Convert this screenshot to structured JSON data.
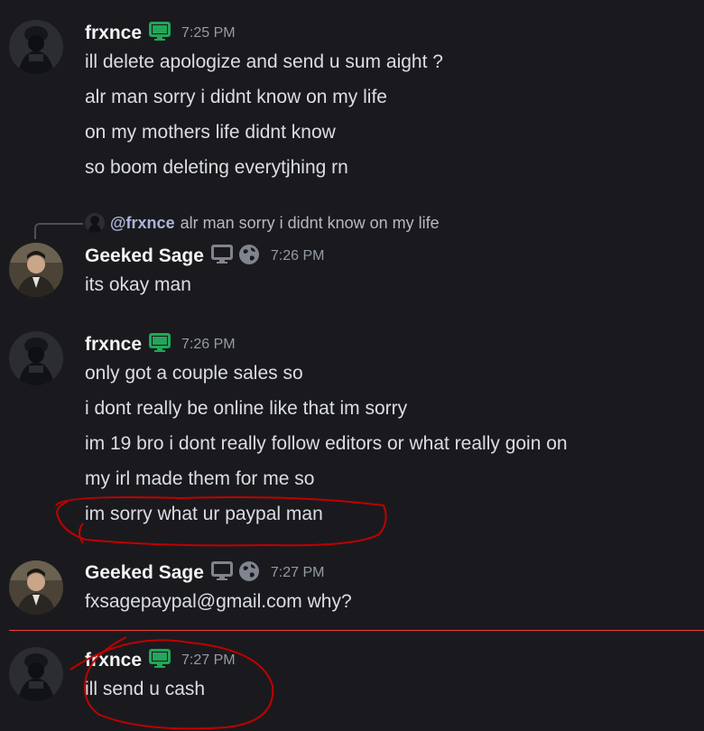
{
  "messages": [
    {
      "author": "frxnce",
      "timestamp": "7:25 PM",
      "lines": [
        "ill delete apologize and send u sum aight ?",
        "alr man sorry i didnt know on my life",
        "on my mothers life didnt know",
        "so boom deleting everytjhing rn"
      ]
    },
    {
      "reply": {
        "mention": "@frxnce",
        "text": "alr man sorry i didnt know on my life"
      },
      "author": "Geeked Sage",
      "timestamp": "7:26 PM",
      "lines": [
        "its okay man"
      ]
    },
    {
      "author": "frxnce",
      "timestamp": "7:26 PM",
      "lines": [
        "only got a couple sales so",
        "i dont really be online like that im sorry",
        "im 19 bro i dont really follow editors or what really goin on",
        "my irl made them for me so",
        "im sorry what ur paypal man"
      ]
    },
    {
      "author": "Geeked Sage",
      "timestamp": "7:27 PM",
      "lines": [
        "fxsagepaypal@gmail.com why?"
      ]
    },
    {
      "author": "frxnce",
      "timestamp": "7:27 PM",
      "lines": [
        "ill send u cash"
      ]
    }
  ],
  "icons": {
    "desktop_status": "desktop-icon",
    "web_status": "globe-icon"
  },
  "colors": {
    "background": "#1a1a1e",
    "online_green": "#23a55a",
    "new_messages_divider": "#f23f42",
    "annotation_red": "#c00000"
  }
}
